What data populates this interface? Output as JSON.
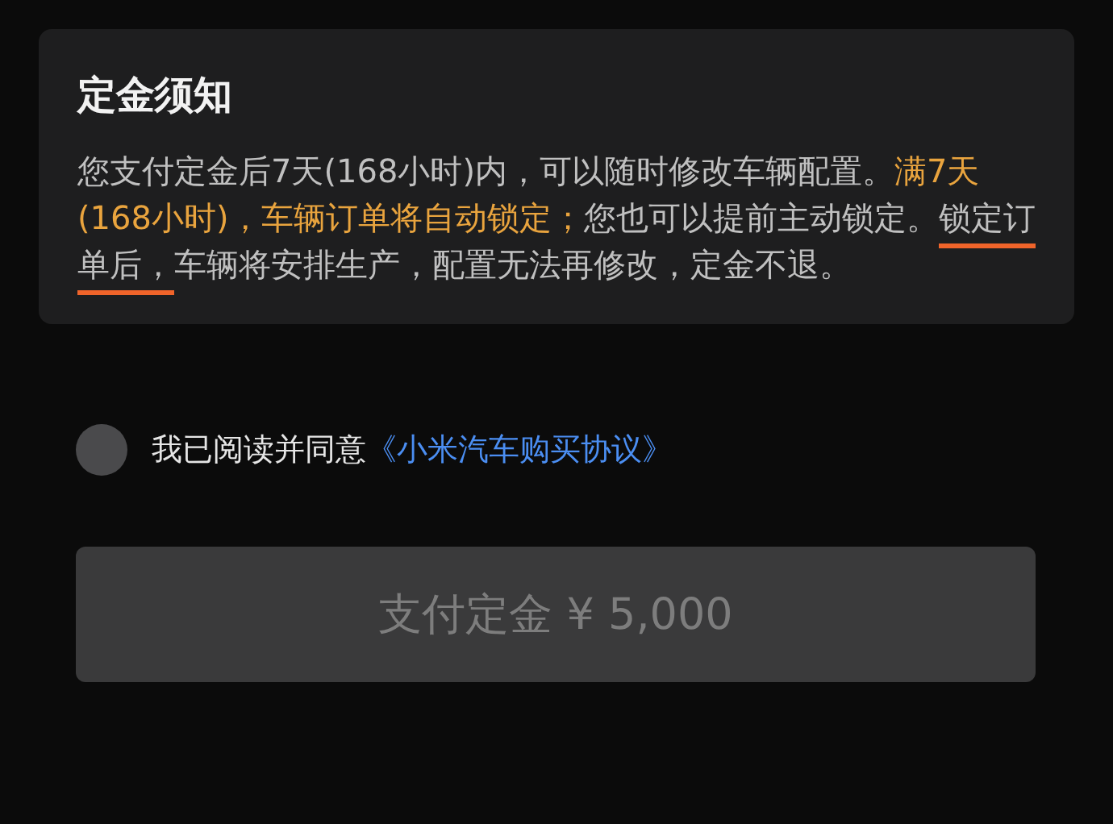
{
  "notice": {
    "title": "定金须知",
    "paragraph": [
      {
        "text": "您支付定金后7天(168小时)内，可以随时修改车辆配置。",
        "kind": "normal",
        "underlined": false
      },
      {
        "text": "满7天(168小时)，车辆订单将自动锁定；",
        "kind": "highlight",
        "underlined": false
      },
      {
        "text": "您也可以提前主动锁定。",
        "kind": "normal",
        "underlined": false
      },
      {
        "text": "锁定订单后，",
        "kind": "normal",
        "underlined": true
      },
      {
        "text": "车辆将安排生产，配置无法再修改，定金不退。",
        "kind": "normal",
        "underlined": false
      }
    ]
  },
  "agreement": {
    "checked": false,
    "label": "我已阅读并同意",
    "link": "《小米汽车购买协议》"
  },
  "pay_button": {
    "label": "支付定金 ¥ 5,000",
    "disabled": true
  }
}
